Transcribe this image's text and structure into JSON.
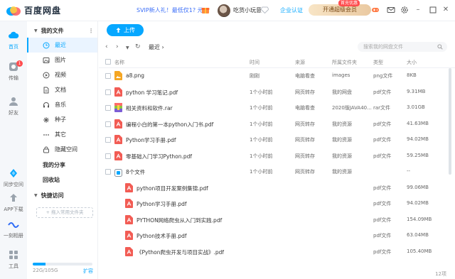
{
  "header": {
    "app_name": "百度网盘",
    "promo": "SVIP新人礼！最低仅1? 元",
    "username": "吃货小玩意",
    "enterprise": "企业认证",
    "vip_button": "开通超级会员",
    "vip_badge": "首充优惠"
  },
  "rail": {
    "items": [
      {
        "label": "首页",
        "icon": "home-cloud-icon"
      },
      {
        "label": "传输",
        "icon": "transfer-icon",
        "badge": "1"
      },
      {
        "label": "好友",
        "icon": "friends-icon"
      },
      {
        "label": "同步空间",
        "icon": "sync-space-icon"
      },
      {
        "label": "APP下载",
        "icon": "app-download-icon"
      },
      {
        "label": "一刻相册",
        "icon": "album-icon"
      },
      {
        "label": "工具",
        "icon": "tools-icon"
      }
    ]
  },
  "sidebar": {
    "my_files": "我的文件",
    "categories": [
      {
        "label": "最近",
        "icon": "clock-icon"
      },
      {
        "label": "图片",
        "icon": "image-icon"
      },
      {
        "label": "视频",
        "icon": "video-icon"
      },
      {
        "label": "文档",
        "icon": "document-icon"
      },
      {
        "label": "音乐",
        "icon": "music-icon"
      },
      {
        "label": "种子",
        "icon": "seed-icon"
      },
      {
        "label": "其它",
        "icon": "other-icon"
      },
      {
        "label": "隐藏空间",
        "icon": "hidden-space-icon"
      }
    ],
    "my_share": "我的分享",
    "recycle": "回收站",
    "quick_access": "快捷访问",
    "add_folder": "+ 拖入常用文件夹",
    "storage_text": "22G/105G",
    "storage_ratio": 0.21,
    "expand": "扩容"
  },
  "main": {
    "upload_label": "上传",
    "breadcrumb": "最近",
    "search_placeholder": "搜索我的网盘文件",
    "columns": [
      "名称",
      "时间",
      "来源",
      "所属文件夹",
      "类型",
      "大小"
    ],
    "rows": [
      {
        "name": "a8.png",
        "time": "刚刚",
        "source": "电脑看查",
        "folder": "images",
        "type": "png文件",
        "size": "8KB",
        "icon": "png"
      },
      {
        "name": "python 学习笔记.pdf",
        "time": "1个小时前",
        "source": "网页转存",
        "folder": "我的网盘",
        "type": "pdf文件",
        "size": "9.31MB",
        "icon": "pdf"
      },
      {
        "name": "相关资料和软件.rar",
        "time": "1个小时前",
        "source": "电脑看查",
        "folder": "2020版JAVA40...",
        "type": "rar文件",
        "size": "3.01GB",
        "icon": "rar"
      },
      {
        "name": "编程小白的第一本python入门书.pdf",
        "time": "1个小时前",
        "source": "网页转存",
        "folder": "我的资源",
        "type": "pdf文件",
        "size": "41.63MB",
        "icon": "pdf"
      },
      {
        "name": "Python学习手册.pdf",
        "time": "1个小时前",
        "source": "网页转存",
        "folder": "我的资源",
        "type": "pdf文件",
        "size": "94.02MB",
        "icon": "pdf"
      },
      {
        "name": "零基础入门学习Python.pdf",
        "time": "1个小时前",
        "source": "网页转存",
        "folder": "我的资源",
        "type": "pdf文件",
        "size": "59.25MB",
        "icon": "pdf"
      },
      {
        "name": "8个文件",
        "time": "1个小时前",
        "source": "网页转存",
        "folder": "我的资源",
        "type": "",
        "size": "--",
        "icon": "group"
      }
    ],
    "sub_rows": [
      {
        "name": "python项目开发案例集锦.pdf",
        "type": "pdf文件",
        "size": "99.06MB"
      },
      {
        "name": "Python学习手册.pdf",
        "type": "pdf文件",
        "size": "94.02MB"
      },
      {
        "name": "PYTHON网络爬虫从入门到实践.pdf",
        "type": "pdf文件",
        "size": "154.09MB"
      },
      {
        "name": "Python技术手册.pdf",
        "type": "pdf文件",
        "size": "63.04MB"
      },
      {
        "name": "《Python爬虫开发与项目实战》.pdf",
        "type": "pdf文件",
        "size": "105.40MB"
      }
    ],
    "footer_count": "12项"
  },
  "colors": {
    "accent": "#06a7ff",
    "pdf": "#f25c54",
    "png": "#f5a623",
    "rar": "#8cc63f"
  }
}
